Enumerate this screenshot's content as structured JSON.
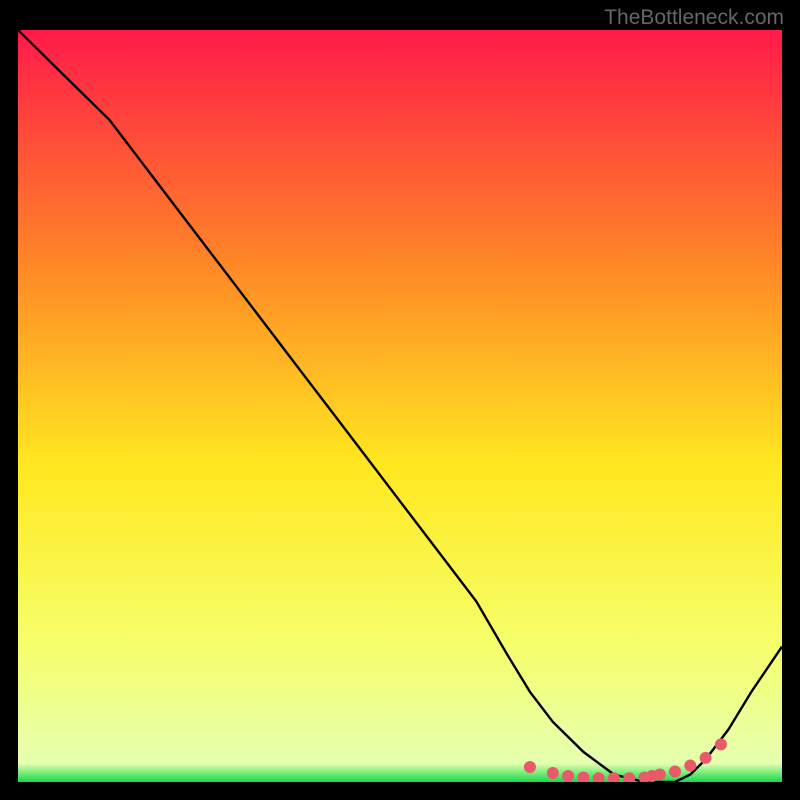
{
  "watermark": "TheBottleneck.com",
  "chart_data": {
    "type": "line",
    "title": "",
    "xlabel": "",
    "ylabel": "",
    "xlim": [
      0,
      100
    ],
    "ylim": [
      0,
      100
    ],
    "background_gradient": {
      "top": "#ff1a49",
      "upper_mid": "#ff8a26",
      "mid": "#ffe820",
      "lower_mid": "#f6ff6c",
      "bottom": "#14d94a"
    },
    "series": [
      {
        "name": "bottleneck-curve",
        "color": "#000000",
        "x": [
          0,
          6,
          12,
          18,
          24,
          30,
          36,
          42,
          48,
          54,
          60,
          64,
          67,
          70,
          74,
          78,
          82,
          86,
          88,
          90,
          93,
          96,
          100
        ],
        "y": [
          100,
          94,
          88,
          80,
          72,
          64,
          56,
          48,
          40,
          32,
          24,
          17,
          12,
          8,
          4,
          1,
          0,
          0,
          1,
          3,
          7,
          12,
          18
        ]
      }
    ],
    "optimal_markers": {
      "name": "optimal-range",
      "color": "#e85a6a",
      "x": [
        67,
        70,
        72,
        74,
        76,
        78,
        80,
        82,
        83,
        84,
        86,
        88,
        90,
        92
      ],
      "y": [
        2,
        1.2,
        0.8,
        0.6,
        0.5,
        0.5,
        0.5,
        0.6,
        0.8,
        1.0,
        1.4,
        2.2,
        3.2,
        5.0
      ]
    }
  }
}
